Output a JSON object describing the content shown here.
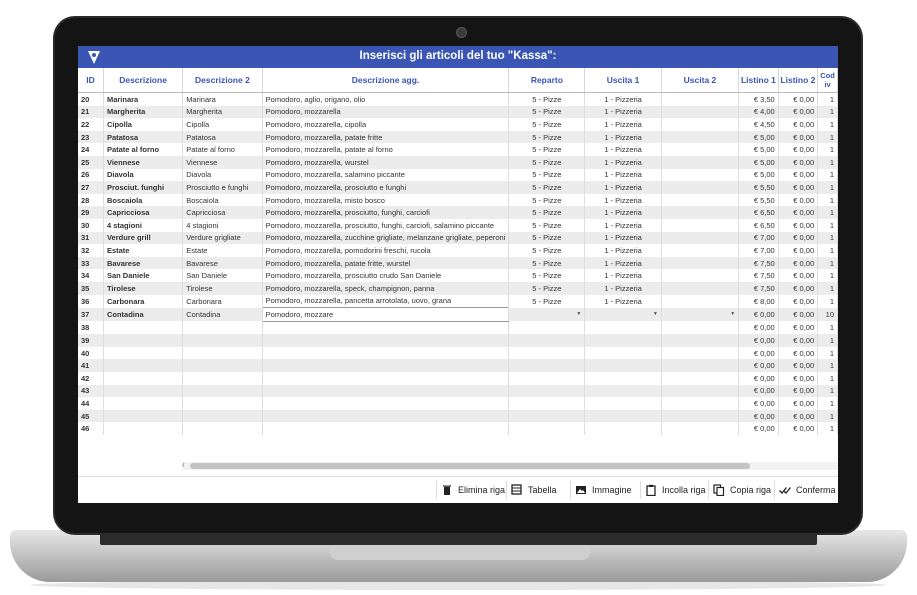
{
  "app": {
    "title": "Inserisci gli articoli del tuo \"Kassa\":"
  },
  "columns": [
    "ID",
    "Descrizione",
    "Descrizione 2",
    "Descrizione agg.",
    "Reparto",
    "Uscita 1",
    "Uscita 2",
    "Listino 1",
    "Listino 2",
    "Cod iv"
  ],
  "rows": [
    {
      "id": "20",
      "d1": "Marinara",
      "d2": "Marinara",
      "agg": "Pomodoro, aglio, origano, olio",
      "rep": "5 - Pizze",
      "u1": "1 - Pizzeria",
      "u2": "",
      "l1": "€ 3,50",
      "l2": "€ 0,00",
      "iva": "1"
    },
    {
      "id": "21",
      "d1": "Margherita",
      "d2": "Margherita",
      "agg": "Pomodoro, mozzarella",
      "rep": "5 - Pizze",
      "u1": "1 - Pizzeria",
      "u2": "",
      "l1": "€ 4,00",
      "l2": "€ 0,00",
      "iva": "1"
    },
    {
      "id": "22",
      "d1": "Cipolla",
      "d2": "Cipolla",
      "agg": "Pomodoro, mozzarella, cipolla",
      "rep": "5 - Pizze",
      "u1": "1 - Pizzeria",
      "u2": "",
      "l1": "€ 4,50",
      "l2": "€ 0,00",
      "iva": "1"
    },
    {
      "id": "23",
      "d1": "Patatosa",
      "d2": "Patatosa",
      "agg": "Pomodoro, mozzarella, patate fritte",
      "rep": "5 - Pizze",
      "u1": "1 - Pizzeria",
      "u2": "",
      "l1": "€ 5,00",
      "l2": "€ 0,00",
      "iva": "1"
    },
    {
      "id": "24",
      "d1": "Patate al forno",
      "d2": "Patate al forno",
      "agg": "Pomodoro, mozzarella, patate al forno",
      "rep": "5 - Pizze",
      "u1": "1 - Pizzeria",
      "u2": "",
      "l1": "€ 5,00",
      "l2": "€ 0,00",
      "iva": "1"
    },
    {
      "id": "25",
      "d1": "Viennese",
      "d2": "Viennese",
      "agg": "Pomodoro, mozzarella, wurstel",
      "rep": "5 - Pizze",
      "u1": "1 - Pizzeria",
      "u2": "",
      "l1": "€ 5,00",
      "l2": "€ 0,00",
      "iva": "1"
    },
    {
      "id": "26",
      "d1": "Diavola",
      "d2": "Diavola",
      "agg": "Pomodoro, mozzarella, salamino piccante",
      "rep": "5 - Pizze",
      "u1": "1 - Pizzeria",
      "u2": "",
      "l1": "€ 5,00",
      "l2": "€ 0,00",
      "iva": "1"
    },
    {
      "id": "27",
      "d1": "Prosciut. funghi",
      "d2": "Prosciutto e funghi",
      "agg": "Pomodoro, mozzarella, prosciutto e funghi",
      "rep": "5 - Pizze",
      "u1": "1 - Pizzeria",
      "u2": "",
      "l1": "€ 5,50",
      "l2": "€ 0,00",
      "iva": "1"
    },
    {
      "id": "28",
      "d1": "Boscaiola",
      "d2": "Boscaiola",
      "agg": "Pomodoro, mozzarella, misto bosco",
      "rep": "5 - Pizze",
      "u1": "1 - Pizzeria",
      "u2": "",
      "l1": "€ 5,50",
      "l2": "€ 0,00",
      "iva": "1"
    },
    {
      "id": "29",
      "d1": "Capricciosa",
      "d2": "Capricciosa",
      "agg": "Pomodoro, mozzarella, prosciutto, funghi, carciofi",
      "rep": "5 - Pizze",
      "u1": "1 - Pizzeria",
      "u2": "",
      "l1": "€ 6,50",
      "l2": "€ 0,00",
      "iva": "1"
    },
    {
      "id": "30",
      "d1": "4 stagioni",
      "d2": "4 stagioni",
      "agg": "Pomodoro, mozzarella, prosciutto, funghi, carciofi, salamino piccante",
      "rep": "5 - Pizze",
      "u1": "1 - Pizzeria",
      "u2": "",
      "l1": "€ 6,50",
      "l2": "€ 0,00",
      "iva": "1"
    },
    {
      "id": "31",
      "d1": "Verdure grill",
      "d2": "Verdure grigliate",
      "agg": "Pomodoro, mozzarella, zucchine grigliate, melanzane grigliate, peperoni",
      "rep": "5 - Pizze",
      "u1": "1 - Pizzeria",
      "u2": "",
      "l1": "€ 7,00",
      "l2": "€ 0,00",
      "iva": "1"
    },
    {
      "id": "32",
      "d1": "Estate",
      "d2": "Estate",
      "agg": "Pomodoro, mozzarella, pomodorini freschi, rucola",
      "rep": "5 - Pizze",
      "u1": "1 - Pizzeria",
      "u2": "",
      "l1": "€ 7,00",
      "l2": "€ 0,00",
      "iva": "1"
    },
    {
      "id": "33",
      "d1": "Bavarese",
      "d2": "Bavarese",
      "agg": "Pomodoro, mozzarella, patate fritte, wurstel",
      "rep": "5 - Pizze",
      "u1": "1 - Pizzeria",
      "u2": "",
      "l1": "€ 7,50",
      "l2": "€ 0,00",
      "iva": "1"
    },
    {
      "id": "34",
      "d1": "San Daniele",
      "d2": "San Daniele",
      "agg": "Pomodoro, mozzarella, prosciutto crudo San Daniele",
      "rep": "5 - Pizze",
      "u1": "1 - Pizzeria",
      "u2": "",
      "l1": "€ 7,50",
      "l2": "€ 0,00",
      "iva": "1"
    },
    {
      "id": "35",
      "d1": "Tirolese",
      "d2": "Tirolese",
      "agg": "Pomodoro, mozzarella, speck, champignon, panna",
      "rep": "5 - Pizze",
      "u1": "1 - Pizzeria",
      "u2": "",
      "l1": "€ 7,50",
      "l2": "€ 0,00",
      "iva": "1"
    },
    {
      "id": "36",
      "d1": "Carbonara",
      "d2": "Carbonara",
      "agg": "Pomodoro, mozzarella, pancetta arrotolata, uovo, grana",
      "rep": "5 - Pizze",
      "u1": "1 - Pizzeria",
      "u2": "",
      "l1": "€ 8,00",
      "l2": "€ 0,00",
      "iva": "1"
    },
    {
      "id": "37",
      "d1": "Contadina",
      "d2": "Contadina",
      "agg": "Pomodoro, mozzare",
      "rep": "",
      "u1": "",
      "u2": "",
      "l1": "€ 0,00",
      "l2": "€ 0,00",
      "iva": "10"
    },
    {
      "id": "38",
      "d1": "",
      "d2": "",
      "agg": "",
      "rep": "",
      "u1": "",
      "u2": "",
      "l1": "€ 0,00",
      "l2": "€ 0,00",
      "iva": "1"
    },
    {
      "id": "39",
      "d1": "",
      "d2": "",
      "agg": "",
      "rep": "",
      "u1": "",
      "u2": "",
      "l1": "€ 0,00",
      "l2": "€ 0,00",
      "iva": "1"
    },
    {
      "id": "40",
      "d1": "",
      "d2": "",
      "agg": "",
      "rep": "",
      "u1": "",
      "u2": "",
      "l1": "€ 0,00",
      "l2": "€ 0,00",
      "iva": "1"
    },
    {
      "id": "41",
      "d1": "",
      "d2": "",
      "agg": "",
      "rep": "",
      "u1": "",
      "u2": "",
      "l1": "€ 0,00",
      "l2": "€ 0,00",
      "iva": "1"
    },
    {
      "id": "42",
      "d1": "",
      "d2": "",
      "agg": "",
      "rep": "",
      "u1": "",
      "u2": "",
      "l1": "€ 0,00",
      "l2": "€ 0,00",
      "iva": "1"
    },
    {
      "id": "43",
      "d1": "",
      "d2": "",
      "agg": "",
      "rep": "",
      "u1": "",
      "u2": "",
      "l1": "€ 0,00",
      "l2": "€ 0,00",
      "iva": "1"
    },
    {
      "id": "44",
      "d1": "",
      "d2": "",
      "agg": "",
      "rep": "",
      "u1": "",
      "u2": "",
      "l1": "€ 0,00",
      "l2": "€ 0,00",
      "iva": "1"
    },
    {
      "id": "45",
      "d1": "",
      "d2": "",
      "agg": "",
      "rep": "",
      "u1": "",
      "u2": "",
      "l1": "€ 0,00",
      "l2": "€ 0,00",
      "iva": "1"
    },
    {
      "id": "46",
      "d1": "",
      "d2": "",
      "agg": "",
      "rep": "",
      "u1": "",
      "u2": "",
      "l1": "€ 0,00",
      "l2": "€ 0,00",
      "iva": "1"
    }
  ],
  "toolbar": {
    "delete_row": "Elimina riga",
    "table": "Tabella",
    "image": "Immagine",
    "paste_row": "Incolla riga",
    "copy_row": "Copia riga",
    "confirm": "Conferma"
  },
  "colors": {
    "accent": "#3a55b4"
  }
}
